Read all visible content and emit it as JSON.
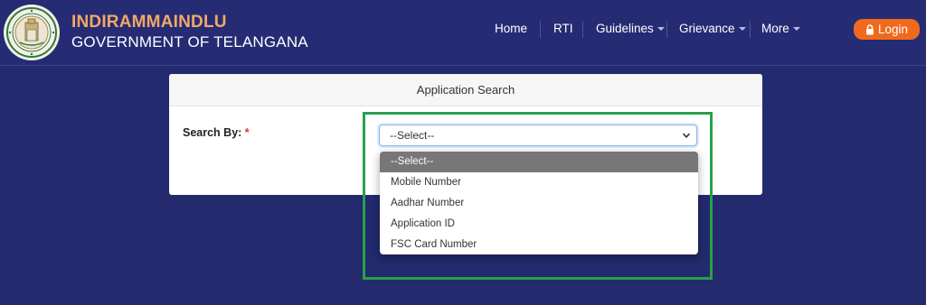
{
  "header": {
    "title": "INDIRAMMAINDLU",
    "subtitle": "GOVERNMENT OF TELANGANA",
    "logo_icon": "telangana-emblem-icon"
  },
  "nav": {
    "items": [
      {
        "label": "Home",
        "has_dropdown": false
      },
      {
        "label": "RTI",
        "has_dropdown": false
      },
      {
        "label": "Guidelines",
        "has_dropdown": true
      },
      {
        "label": "Grievance",
        "has_dropdown": true
      },
      {
        "label": "More",
        "has_dropdown": true
      }
    ],
    "login_label": "Login",
    "login_icon": "lock-icon"
  },
  "form": {
    "card_title": "Application Search",
    "search_by_label": "Search By:",
    "required_mark": "*",
    "select_value": "--Select--",
    "options": [
      "--Select--",
      "Mobile Number",
      "Aadhar Number",
      "Application ID",
      "FSC Card Number"
    ],
    "selected_index": 0
  },
  "colors": {
    "background": "#232a6d",
    "brand_title": "#f2a867",
    "login_button": "#f06a1d",
    "highlight_border": "#28a04a",
    "selected_option": "#777777"
  }
}
